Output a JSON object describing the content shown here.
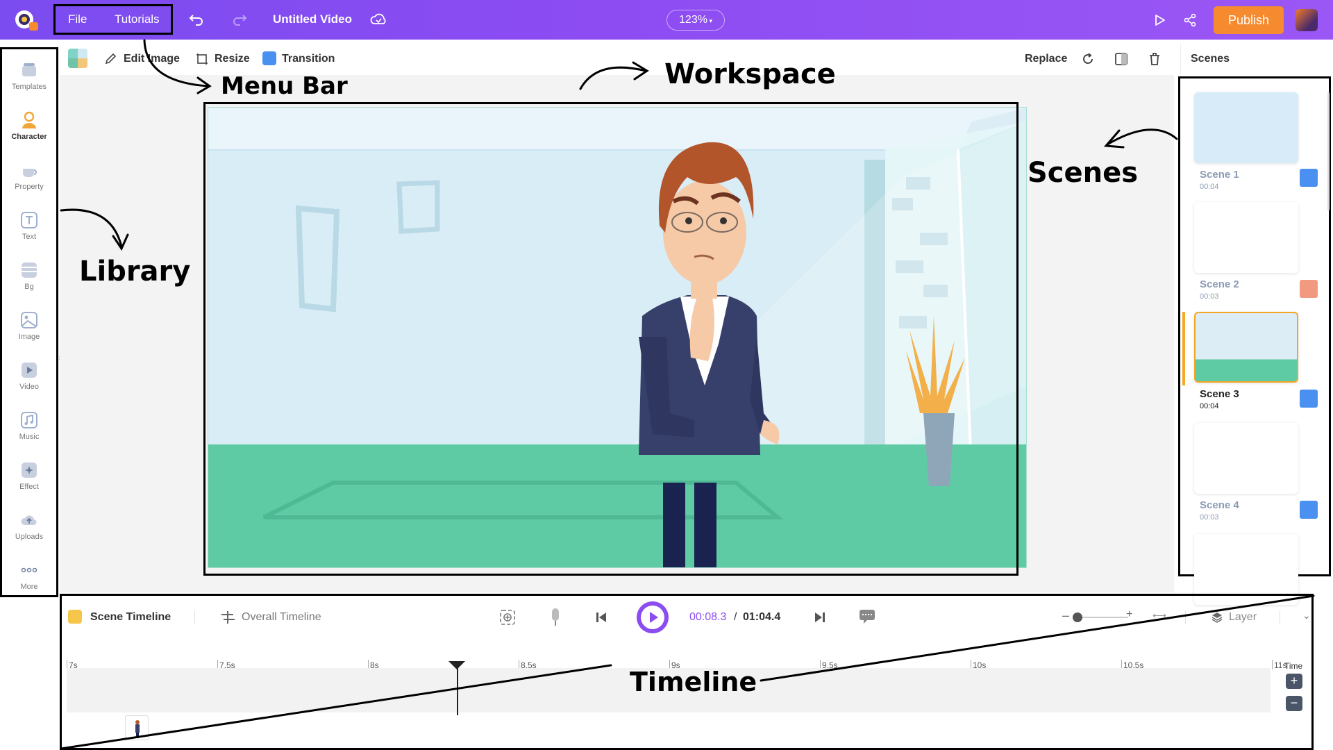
{
  "topbar": {
    "menu": [
      {
        "label": "File"
      },
      {
        "label": "Tutorials"
      }
    ],
    "title": "Untitled Video",
    "zoom": "123%",
    "publish_label": "Publish",
    "icons": [
      "undo-icon",
      "redo-icon",
      "cloud-save-icon",
      "preview-play-icon",
      "share-icon"
    ]
  },
  "toolbar": {
    "edit_image": "Edit Image",
    "resize": "Resize",
    "transition": "Transition",
    "replace": "Replace"
  },
  "library": {
    "items": [
      {
        "label": "Templates",
        "icon": "templates-icon"
      },
      {
        "label": "Character",
        "icon": "character-icon",
        "active": true
      },
      {
        "label": "Property",
        "icon": "property-icon"
      },
      {
        "label": "Text",
        "icon": "text-icon"
      },
      {
        "label": "Bg",
        "icon": "background-icon"
      },
      {
        "label": "Image",
        "icon": "image-icon"
      },
      {
        "label": "Video",
        "icon": "video-icon"
      },
      {
        "label": "Music",
        "icon": "music-icon"
      },
      {
        "label": "Effect",
        "icon": "effect-icon"
      },
      {
        "label": "Uploads",
        "icon": "uploads-icon"
      },
      {
        "label": "More",
        "icon": "more-icon"
      }
    ]
  },
  "scenes": {
    "header": "Scenes",
    "items": [
      {
        "name": "Scene 1",
        "duration": "00:04",
        "transition_color": "#4a90f0"
      },
      {
        "name": "Scene 2",
        "duration": "00:03",
        "transition_color": "#f19a80"
      },
      {
        "name": "Scene 3",
        "duration": "00:04",
        "transition_color": "#4a90f0",
        "active": true
      },
      {
        "name": "Scene 4",
        "duration": "00:03",
        "transition_color": "#4a90f0"
      }
    ]
  },
  "timeline": {
    "scene_tab": "Scene Timeline",
    "overall_tab": "Overall Timeline",
    "current_time": "00:08.3",
    "separator": " / ",
    "total_time": "01:04.4",
    "layer_label": "Layer",
    "time_label": "Time",
    "ruler": [
      "7s",
      "7.5s",
      "8s",
      "8.5s",
      "9s",
      "9.5s",
      "10s",
      "10.5s",
      "11s"
    ]
  },
  "annotations": {
    "menu_bar": "Menu Bar",
    "workspace": "Workspace",
    "scenes": "Scenes",
    "library": "Library",
    "timeline": "Timeline"
  },
  "colors": {
    "topbar": "#8a4cf2",
    "publish": "#f68a2e",
    "play": "#8b4cf0",
    "active_scene": "#f5a623"
  }
}
